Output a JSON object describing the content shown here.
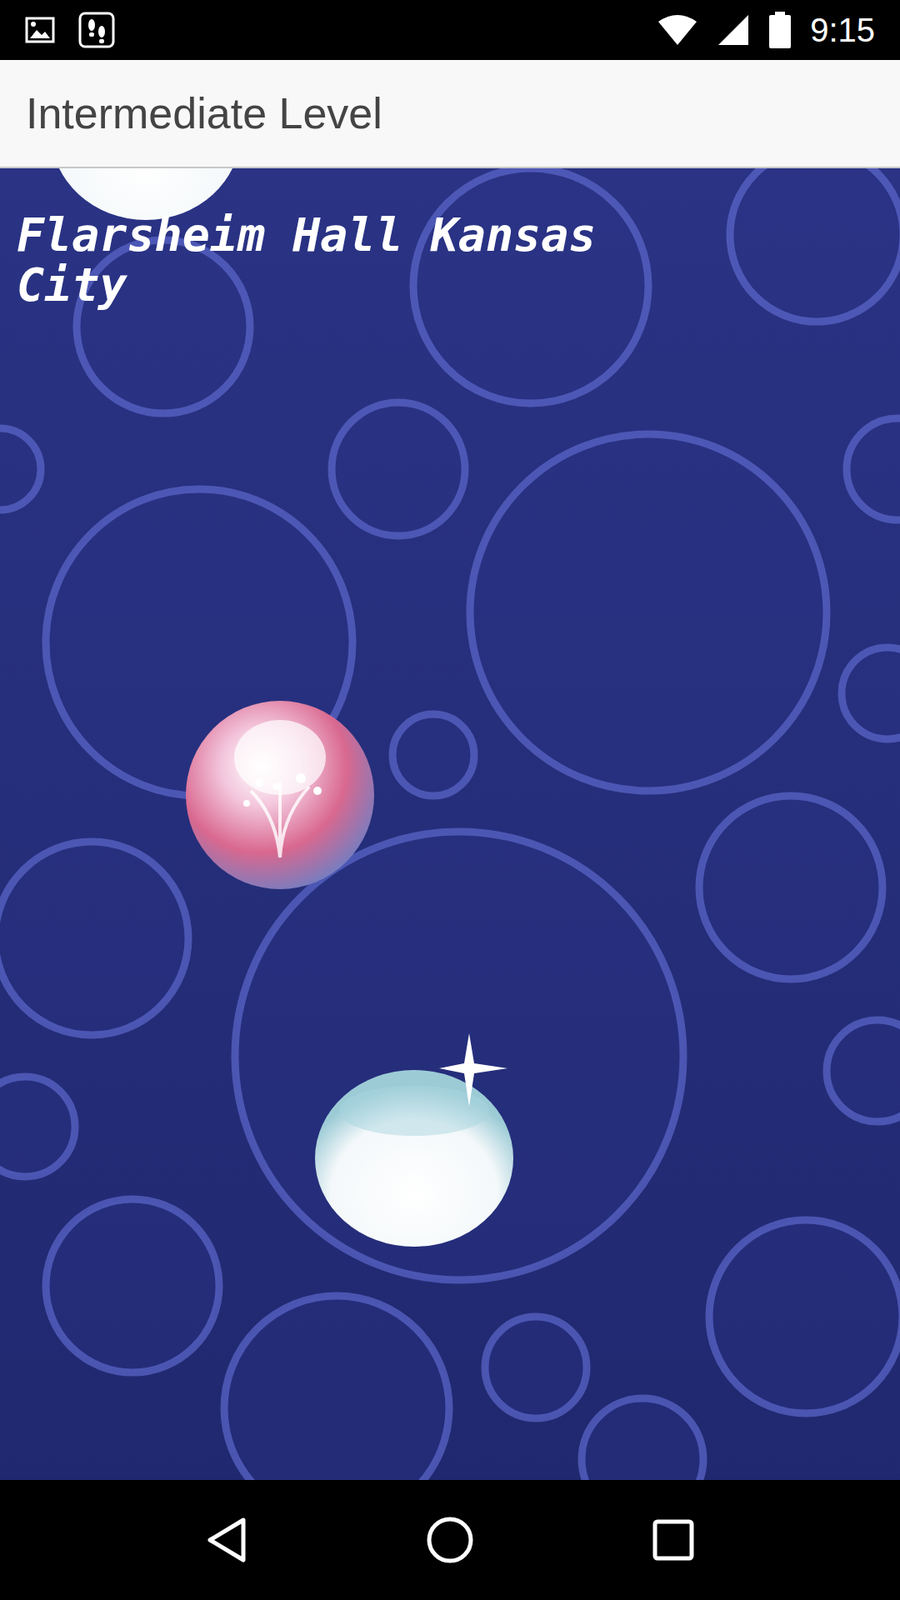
{
  "status_bar": {
    "time": "9:15"
  },
  "app_bar": {
    "title": "Intermediate Level"
  },
  "game": {
    "clue": "Flarsheim Hall Kansas City"
  }
}
